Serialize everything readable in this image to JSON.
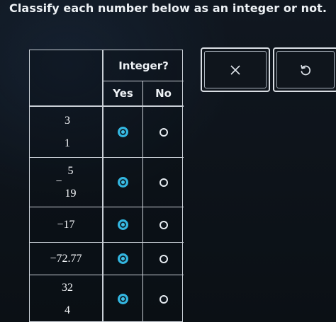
{
  "prompt": "Classify each number below as an integer or not.",
  "table": {
    "header_group": "Integer?",
    "columns": [
      "Yes",
      "No"
    ],
    "rows": [
      {
        "type": "fraction",
        "sign": "",
        "numerator": "3",
        "denominator": "1",
        "selected": "Yes"
      },
      {
        "type": "fraction",
        "sign": "−",
        "numerator": "5",
        "denominator": "19",
        "selected": "Yes"
      },
      {
        "type": "value",
        "text": "−17",
        "selected": "Yes"
      },
      {
        "type": "value",
        "text": "−72.77",
        "selected": "Yes"
      },
      {
        "type": "fraction",
        "sign": "",
        "numerator": "32",
        "denominator": "4",
        "selected": "Yes"
      }
    ]
  },
  "actions": {
    "clear_icon": "x-icon",
    "reset_icon": "undo-icon"
  },
  "colors": {
    "selected_radio": "#3fc2ea",
    "background": "#0c1116"
  }
}
